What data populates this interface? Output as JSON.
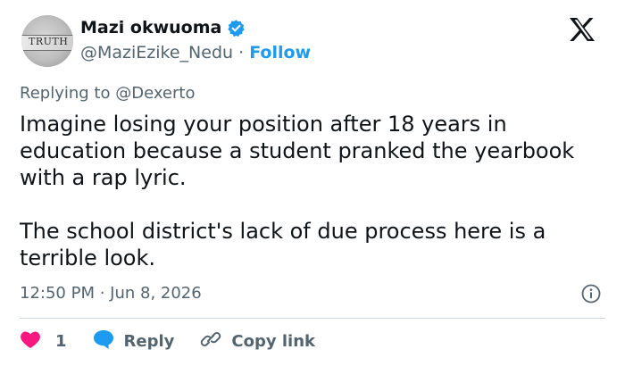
{
  "author": {
    "name": "Mazi okwuoma",
    "handle": "@MaziEzike_Nedu",
    "separator": "·",
    "follow_label": "Follow",
    "avatar_text": "TRUTH",
    "verified": true
  },
  "reply_context": {
    "prefix": "Replying to",
    "mention": "@Dexerto"
  },
  "tweet": {
    "paragraphs": [
      "Imagine losing your position after 18 years in education because a student pranked the yearbook with a rap lyric.",
      "The school district's lack of due process here is a terrible look."
    ],
    "timestamp": "12:50 PM · Jun 8, 2026"
  },
  "actions": {
    "like_count": "1",
    "reply_label": "Reply",
    "copy_link_label": "Copy link"
  },
  "colors": {
    "accent": "#1d9bf0",
    "like": "#f91880",
    "muted": "#536471",
    "text": "#0f1419"
  },
  "icons": {
    "platform": "x-logo-icon",
    "verified": "verified-badge-icon",
    "info": "info-icon",
    "like": "heart-icon",
    "reply": "speech-bubble-icon",
    "copy": "link-icon"
  }
}
